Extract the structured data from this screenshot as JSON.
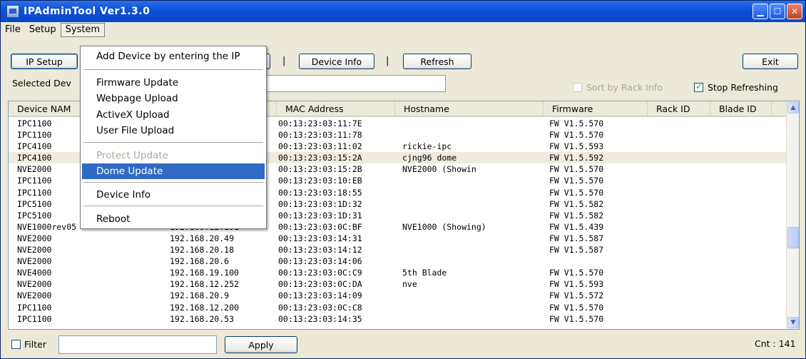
{
  "window": {
    "title": "IPAdminTool Ver1.3.0",
    "controls": {
      "minimize": "▁",
      "maximize": "☐",
      "close": "✕"
    }
  },
  "menubar": {
    "items": [
      "File",
      "Setup",
      "System"
    ],
    "active": "System"
  },
  "toolbar": {
    "ip_setup": "IP Setup",
    "device_info": "Device Info",
    "refresh": "Refresh",
    "exit": "Exit",
    "separator": "|"
  },
  "selection": {
    "label": "Selected Dev",
    "value": ""
  },
  "options": {
    "sort_by_rack": {
      "label": "Sort by Rack Info",
      "checked": false,
      "enabled": false
    },
    "stop_refreshing": {
      "label": "Stop Refreshing",
      "checked": true
    }
  },
  "table": {
    "columns": [
      "Device NAM",
      "",
      "MAC Address",
      "Hostname",
      "Firmware",
      "Rack ID",
      "Blade ID"
    ],
    "rows": [
      {
        "device": "IPC1100",
        "ip": "",
        "mac": "00:13:23:03:11:7E",
        "hostname": "",
        "firmware": "FW V1.5.570"
      },
      {
        "device": "IPC1100",
        "ip": "",
        "mac": "00:13:23:03:11:78",
        "hostname": "",
        "firmware": "FW V1.5.570"
      },
      {
        "device": "IPC4100",
        "ip": "",
        "mac": "00:13:23:03:11:02",
        "hostname": "rickie-ipc",
        "firmware": "FW V1.5.593"
      },
      {
        "device": "IPC4100",
        "ip": "",
        "mac": "00:13:23:03:15:2A",
        "hostname": "cjng96 dome",
        "firmware": "FW V1.5.592",
        "highlight": true
      },
      {
        "device": "NVE2000",
        "ip": "",
        "mac": "00:13:23:03:15:2B",
        "hostname": "NVE2000 (Showin",
        "firmware": "FW V1.5.570"
      },
      {
        "device": "IPC1100",
        "ip": "",
        "mac": "00:13:23:03:10:EB",
        "hostname": "",
        "firmware": "FW V1.5.570"
      },
      {
        "device": "IPC1100",
        "ip": "",
        "mac": "00:13:23:03:18:55",
        "hostname": "",
        "firmware": "FW V1.5.570"
      },
      {
        "device": "IPC5100",
        "ip": "",
        "mac": "00:13:23:03:1D:32",
        "hostname": "",
        "firmware": "FW V1.5.582"
      },
      {
        "device": "IPC5100",
        "ip": "",
        "mac": "00:13:23:03:1D:31",
        "hostname": "",
        "firmware": "FW V1.5.582"
      },
      {
        "device": "NVE1000rev05",
        "ip": "192.168.12.191",
        "mac": "00:13:23:03:0C:BF",
        "hostname": "NVE1000 (Showing)",
        "firmware": "FW V1.5.439"
      },
      {
        "device": "NVE2000",
        "ip": "192.168.20.49",
        "mac": "00:13:23:03:14:31",
        "hostname": "",
        "firmware": "FW V1.5.587"
      },
      {
        "device": "NVE2000",
        "ip": "192.168.20.18",
        "mac": "00:13:23:03:14:12",
        "hostname": "",
        "firmware": "FW V1.5.587"
      },
      {
        "device": "NVE2000",
        "ip": "192.168.20.6",
        "mac": "00:13:23:03:14:06",
        "hostname": "",
        "firmware": ""
      },
      {
        "device": "NVE4000",
        "ip": "192.168.19.100",
        "mac": "00:13:23:03:0C:C9",
        "hostname": "5th Blade",
        "firmware": "FW V1.5.570"
      },
      {
        "device": "NVE2000",
        "ip": "192.168.12.252",
        "mac": "00:13:23:03:0C:DA",
        "hostname": "nve",
        "firmware": "FW V1.5.593"
      },
      {
        "device": "NVE2000",
        "ip": "192.168.20.9",
        "mac": "00:13:23:03:14:09",
        "hostname": "",
        "firmware": "FW V1.5.572"
      },
      {
        "device": "IPC1100",
        "ip": "192.168.12.200",
        "mac": "00:13:23:03:0C:C8",
        "hostname": "",
        "firmware": "FW V1.5.570"
      },
      {
        "device": "IPC1100",
        "ip": "192.168.20.53",
        "mac": "00:13:23:03:14:35",
        "hostname": "",
        "firmware": "FW V1.5.570"
      }
    ]
  },
  "system_menu": {
    "items": [
      {
        "label": "Add Device by entering the IP"
      },
      {
        "label": "Firmware Update"
      },
      {
        "label": "Webpage Upload"
      },
      {
        "label": "ActiveX Upload"
      },
      {
        "label": "User File Upload"
      },
      {
        "label": "Protect Update",
        "disabled": true
      },
      {
        "label": "Dome Update",
        "selected": true
      },
      {
        "label": "Device Info"
      },
      {
        "label": "Reboot"
      }
    ]
  },
  "footer": {
    "filter_label": "Filter",
    "filter_value": "",
    "apply": "Apply",
    "count": "Cnt : 141"
  },
  "scrollbar": {
    "up": "▲",
    "down": "▼"
  }
}
